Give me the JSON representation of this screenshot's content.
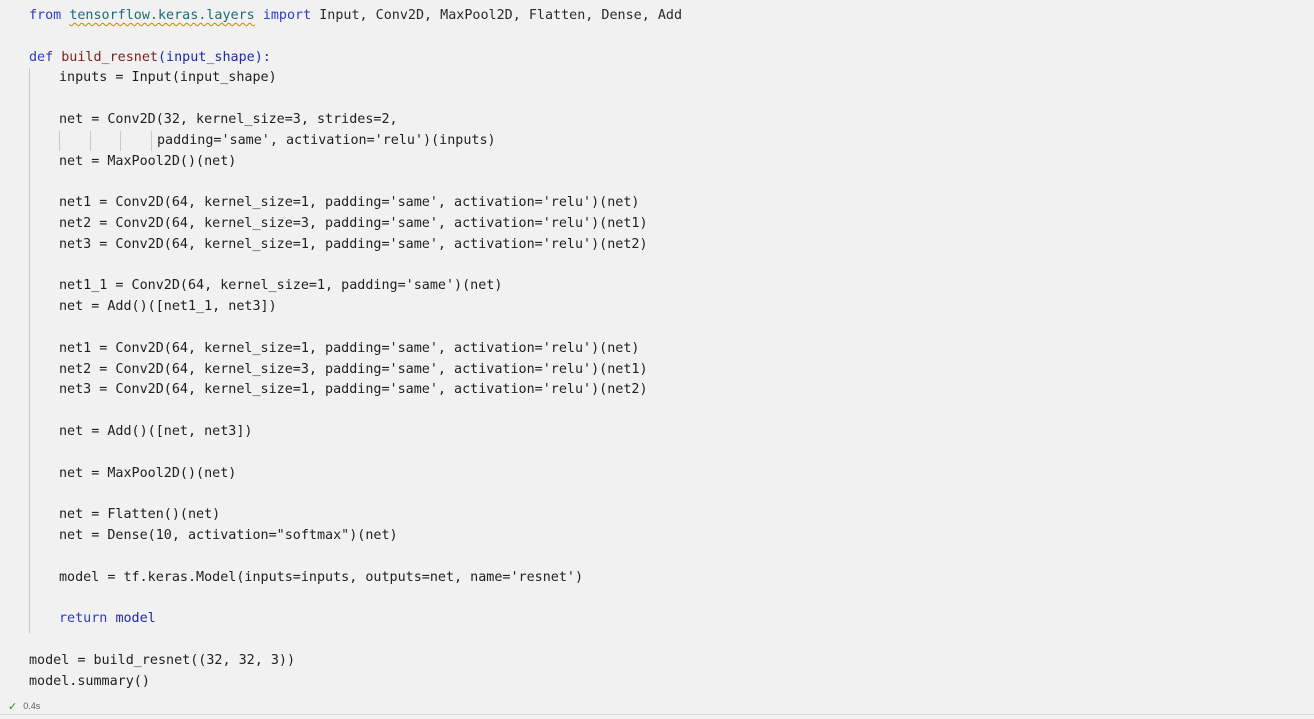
{
  "code": {
    "l1": {
      "from": "from",
      "module": "tensorflow.keras.layers",
      "import": "import",
      "names": "Input, Conv2D, MaxPool2D, Flatten, Dense, Add"
    },
    "l3": {
      "def": "def",
      "name": "build_resnet",
      "params": "(input_shape):"
    },
    "l4": "inputs = Input(input_shape)",
    "l6a": "net = Conv2D(32, kernel_size=3, strides=2,",
    "l6b": "padding='same', activation='relu')(inputs)",
    "l7": "net = MaxPool2D()(net)",
    "l9": "net1 = Conv2D(64, kernel_size=1, padding='same', activation='relu')(net)",
    "l10": "net2 = Conv2D(64, kernel_size=3, padding='same', activation='relu')(net1)",
    "l11": "net3 = Conv2D(64, kernel_size=1, padding='same', activation='relu')(net2)",
    "l13": "net1_1 = Conv2D(64, kernel_size=1, padding='same')(net)",
    "l14": "net = Add()([net1_1, net3])",
    "l16": "net1 = Conv2D(64, kernel_size=1, padding='same', activation='relu')(net)",
    "l17": "net2 = Conv2D(64, kernel_size=3, padding='same', activation='relu')(net1)",
    "l18": "net3 = Conv2D(64, kernel_size=1, padding='same', activation='relu')(net2)",
    "l20": "net = Add()([net, net3])",
    "l22": "net = MaxPool2D()(net)",
    "l24": "net = Flatten()(net)",
    "l25": "net = Dense(10, activation=\"softmax\")(net)",
    "l27": "model = tf.keras.Model(inputs=inputs, outputs=net, name='resnet')",
    "l29": {
      "return": "return",
      "value": "model"
    },
    "l31": "model = build_resnet((32, 32, 3))",
    "l32": "model.summary()"
  },
  "status": {
    "check_icon": "check-icon",
    "time": "0.4s",
    "color": "#2e8b2e"
  }
}
